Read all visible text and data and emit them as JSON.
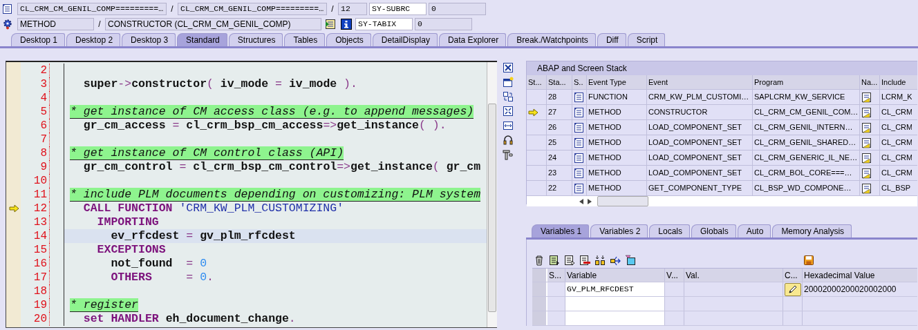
{
  "context": {
    "separators": [
      "/",
      "/",
      "/"
    ],
    "program": "CL_CRM_CM_GENIL_COMP=========…",
    "include": "CL_CRM_CM_GENIL_COMP=========…",
    "line": "12",
    "event_type": "METHOD",
    "event": "CONSTRUCTOR (CL_CRM_CM_GENIL_COMP)",
    "system_fields": [
      {
        "name": "SY-SUBRC",
        "value": "0"
      },
      {
        "name": "SY-TABIX",
        "value": "0"
      }
    ]
  },
  "tabs": [
    {
      "label": "Desktop 1",
      "selected": false
    },
    {
      "label": "Desktop 2",
      "selected": false
    },
    {
      "label": "Desktop 3",
      "selected": false
    },
    {
      "label": "Standard",
      "selected": true
    },
    {
      "label": "Structures",
      "selected": false
    },
    {
      "label": "Tables",
      "selected": false
    },
    {
      "label": "Objects",
      "selected": false
    },
    {
      "label": "DetailDisplay",
      "selected": false
    },
    {
      "label": "Data Explorer",
      "selected": false
    },
    {
      "label": "Break./Watchpoints",
      "selected": false
    },
    {
      "label": "Diff",
      "selected": false
    },
    {
      "label": "Script",
      "selected": false
    }
  ],
  "editor": {
    "lines": [
      {
        "number": "2",
        "current": false
      },
      {
        "number": "3",
        "current": false,
        "highlighted": false,
        "comment": false,
        "tokens": [
          {
            "kind": "id",
            "text": "  super"
          },
          {
            "kind": "op",
            "text": "->"
          },
          {
            "kind": "id",
            "text": "constructor"
          },
          {
            "kind": "op",
            "text": "( "
          },
          {
            "kind": "id",
            "text": "iv_mode "
          },
          {
            "kind": "op",
            "text": "= "
          },
          {
            "kind": "id",
            "text": "iv_mode "
          },
          {
            "kind": "op",
            "text": ")."
          }
        ]
      },
      {
        "number": "4",
        "current": false
      },
      {
        "number": "5",
        "current": false,
        "highlighted": false,
        "comment": true,
        "tokens": [
          {
            "kind": "comment",
            "text": "* get instance of CM access class (e.g. to append messages)"
          }
        ]
      },
      {
        "number": "6",
        "current": false,
        "highlighted": false,
        "comment": false,
        "tokens": [
          {
            "kind": "id",
            "text": "  gr_cm_access "
          },
          {
            "kind": "op",
            "text": "= "
          },
          {
            "kind": "id",
            "text": "cl_crm_bsp_cm_access"
          },
          {
            "kind": "op",
            "text": "=>"
          },
          {
            "kind": "id",
            "text": "get_instance"
          },
          {
            "kind": "op",
            "text": "( )."
          }
        ]
      },
      {
        "number": "7",
        "current": false
      },
      {
        "number": "8",
        "current": false,
        "highlighted": false,
        "comment": true,
        "tokens": [
          {
            "kind": "comment",
            "text": "* get instance of CM control class (API)"
          }
        ]
      },
      {
        "number": "9",
        "current": false,
        "highlighted": false,
        "comment": false,
        "tokens": [
          {
            "kind": "id",
            "text": "  gr_cm_control "
          },
          {
            "kind": "op",
            "text": "= "
          },
          {
            "kind": "id",
            "text": "cl_crm_bsp_cm_control"
          },
          {
            "kind": "op",
            "text": "=>"
          },
          {
            "kind": "id",
            "text": "get_instance"
          },
          {
            "kind": "op",
            "text": "( "
          },
          {
            "kind": "id",
            "text": "gr_cm"
          }
        ]
      },
      {
        "number": "10",
        "current": false
      },
      {
        "number": "11",
        "current": false,
        "highlighted": false,
        "comment": true,
        "tokens": [
          {
            "kind": "comment",
            "text": "* include PLM documents depending on customizing: PLM system"
          }
        ]
      },
      {
        "number": "12",
        "current": true,
        "highlighted": false,
        "comment": false,
        "tokens": [
          {
            "kind": "kw",
            "text": "  CALL FUNCTION "
          },
          {
            "kind": "str",
            "text": "'CRM_KW_PLM_CUSTOMIZING'"
          }
        ]
      },
      {
        "number": "13",
        "current": false,
        "highlighted": false,
        "comment": false,
        "tokens": [
          {
            "kind": "kw",
            "text": "    IMPORTING"
          }
        ]
      },
      {
        "number": "14",
        "current": false,
        "highlighted": true,
        "comment": false,
        "tokens": [
          {
            "kind": "id",
            "text": "      ev_rfcdest "
          },
          {
            "kind": "op",
            "text": "= "
          },
          {
            "kind": "id",
            "text": "gv_plm_rfcdest"
          }
        ]
      },
      {
        "number": "15",
        "current": false,
        "highlighted": false,
        "comment": false,
        "tokens": [
          {
            "kind": "kw",
            "text": "    EXCEPTIONS"
          }
        ]
      },
      {
        "number": "16",
        "current": false,
        "highlighted": false,
        "comment": false,
        "tokens": [
          {
            "kind": "id",
            "text": "      not_found  "
          },
          {
            "kind": "op",
            "text": "= "
          },
          {
            "kind": "num",
            "text": "0"
          }
        ]
      },
      {
        "number": "17",
        "current": false,
        "highlighted": false,
        "comment": false,
        "tokens": [
          {
            "kind": "kw",
            "text": "      OTHERS     "
          },
          {
            "kind": "op",
            "text": "= "
          },
          {
            "kind": "num",
            "text": "0"
          },
          {
            "kind": "op",
            "text": "."
          }
        ]
      },
      {
        "number": "18",
        "current": false
      },
      {
        "number": "19",
        "current": false,
        "highlighted": false,
        "comment": true,
        "tokens": [
          {
            "kind": "comment",
            "text": "* register"
          }
        ]
      },
      {
        "number": "20",
        "current": false,
        "highlighted": false,
        "comment": false,
        "tokens": [
          {
            "kind": "kw",
            "text": "  set HANDLER "
          },
          {
            "kind": "id",
            "text": "eh_document_change"
          },
          {
            "kind": "op",
            "text": "."
          }
        ]
      }
    ]
  },
  "stack": {
    "title": "ABAP and Screen Stack",
    "columns": [
      "St...",
      "Sta...",
      "S..",
      "Event Type",
      "Event",
      "Program",
      "Na...",
      "Include"
    ],
    "rows": [
      {
        "current": false,
        "frame": "28",
        "event_type": "FUNCTION",
        "event": "CRM_KW_PLM_CUSTOMI…",
        "program": "SAPLCRM_KW_SERVICE",
        "include": "LCRM_K"
      },
      {
        "current": true,
        "frame": "27",
        "event_type": "METHOD",
        "event": "CONSTRUCTOR",
        "program": "CL_CRM_CM_GENIL_COM…",
        "include": "CL_CRM"
      },
      {
        "current": false,
        "frame": "26",
        "event_type": "METHOD",
        "event": "LOAD_COMPONENT_SET",
        "program": "CL_CRM_GENIL_INTERN…",
        "include": "CL_CRM"
      },
      {
        "current": false,
        "frame": "25",
        "event_type": "METHOD",
        "event": "LOAD_COMPONENT_SET",
        "program": "CL_CRM_GENIL_SHARED…",
        "include": "CL_CRM"
      },
      {
        "current": false,
        "frame": "24",
        "event_type": "METHOD",
        "event": "LOAD_COMPONENT_SET",
        "program": "CL_CRM_GENERIC_IL_NE…",
        "include": "CL_CRM"
      },
      {
        "current": false,
        "frame": "23",
        "event_type": "METHOD",
        "event": "LOAD_COMPONENT_SET",
        "program": "CL_CRM_BOL_CORE===…",
        "include": "CL_CRM"
      },
      {
        "current": false,
        "frame": "22",
        "event_type": "METHOD",
        "event": "GET_COMPONENT_TYPE",
        "program": "CL_BSP_WD_COMPONE…",
        "include": "CL_BSP"
      }
    ]
  },
  "variables": {
    "tabs": [
      {
        "label": "Variables 1",
        "selected": true
      },
      {
        "label": "Variables 2",
        "selected": false
      },
      {
        "label": "Locals",
        "selected": false
      },
      {
        "label": "Globals",
        "selected": false
      },
      {
        "label": "Auto",
        "selected": false
      },
      {
        "label": "Memory Analysis",
        "selected": false
      }
    ],
    "columns": [
      "S...",
      "Variable",
      "V...",
      "Val.",
      "C...",
      "Hexadecimal Value"
    ],
    "rows": [
      {
        "variable": "GV_PLM_RFCDEST",
        "hex_value": "20002000200020002000"
      }
    ]
  }
}
